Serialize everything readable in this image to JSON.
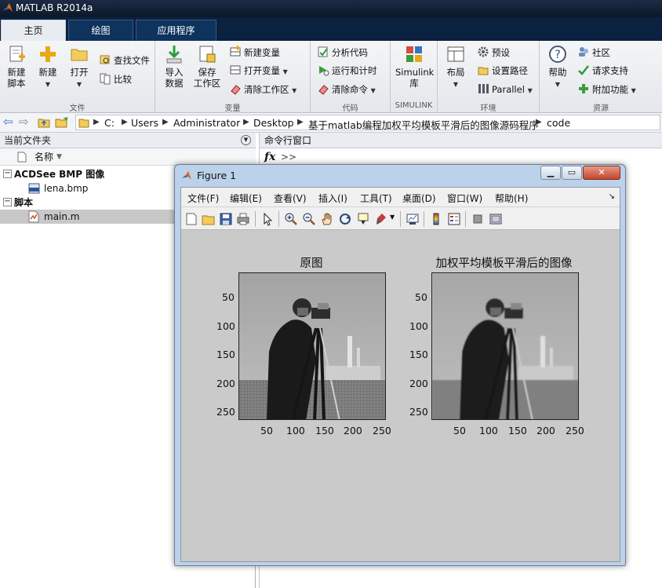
{
  "app": {
    "title": "MATLAB R2014a"
  },
  "tabs": [
    "主页",
    "绘图",
    "应用程序"
  ],
  "ribbon": {
    "file": {
      "title": "文件",
      "new_script": "新建\n脚本",
      "new": "新建",
      "open": "打开",
      "find_files": "查找文件",
      "compare": "比较"
    },
    "variable": {
      "title": "变量",
      "import": "导入\n数据",
      "save_workspace": "保存\n工作区",
      "new_variable": "新建变量",
      "open_variable": "打开变量",
      "clear_workspace": "清除工作区"
    },
    "code": {
      "title": "代码",
      "analyze": "分析代码",
      "run_time": "运行和计时",
      "clear_commands": "清除命令"
    },
    "simulink": {
      "title": "SIMULINK",
      "library": "Simulink\n库"
    },
    "environment": {
      "title": "环境",
      "layout": "布局",
      "preferences": "预设",
      "set_path": "设置路径",
      "parallel": "Parallel"
    },
    "resources": {
      "title": "资源",
      "help": "帮助",
      "community": "社区",
      "support": "请求支持",
      "addons": "附加功能"
    }
  },
  "address": {
    "crumbs": [
      "C:",
      "Users",
      "Administrator",
      "Desktop",
      "基于matlab编程加权平均模板平滑后的图像源码程序",
      "code"
    ]
  },
  "current_folder": {
    "title": "当前文件夹",
    "column_name": "名称",
    "groups": [
      {
        "label": "ACDSee BMP 图像",
        "files": [
          "lena.bmp"
        ]
      },
      {
        "label": "脚本",
        "files": [
          "main.m"
        ]
      }
    ]
  },
  "command_window": {
    "title": "命令行窗口",
    "fx": "fx",
    "prompt": ">>"
  },
  "figure": {
    "title": "Figure 1",
    "menu": [
      "文件(F)",
      "编辑(E)",
      "查看(V)",
      "插入(I)",
      "工具(T)",
      "桌面(D)",
      "窗口(W)",
      "帮助(H)"
    ],
    "axes": [
      {
        "title": "原图",
        "yticks": [
          "50",
          "100",
          "150",
          "200",
          "250"
        ],
        "xticks": [
          "50",
          "100",
          "150",
          "200",
          "250"
        ]
      },
      {
        "title": "加权平均模板平滑后的图像",
        "yticks": [
          "50",
          "100",
          "150",
          "200",
          "250"
        ],
        "xticks": [
          "50",
          "100",
          "150",
          "200",
          "250"
        ]
      }
    ]
  }
}
